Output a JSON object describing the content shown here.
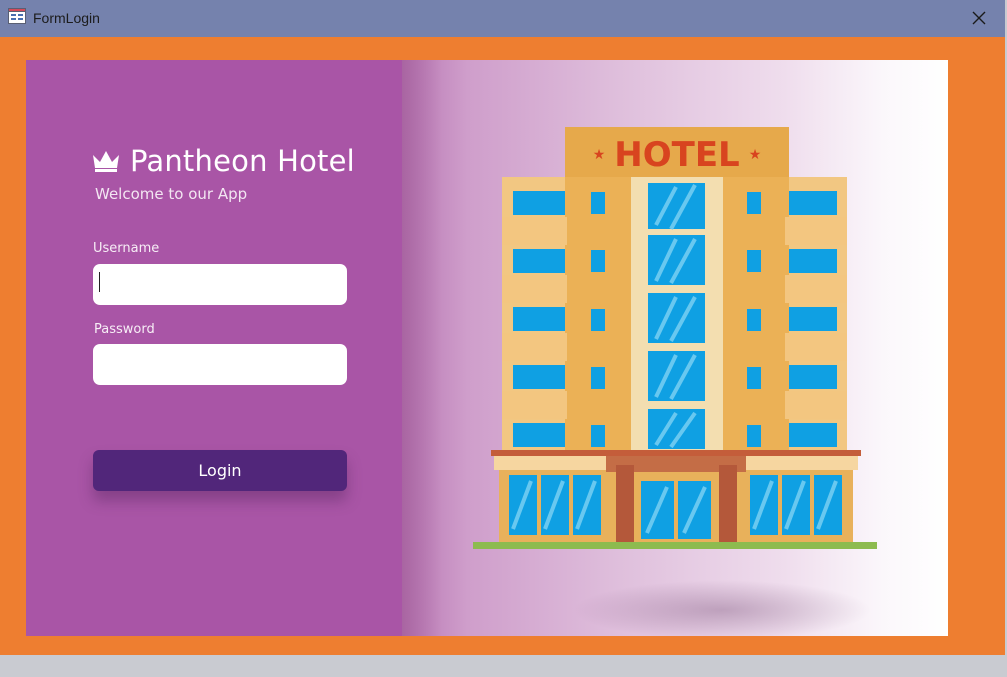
{
  "window": {
    "title": "FormLogin",
    "icon": "form-app-icon",
    "close_icon": "close-icon"
  },
  "colors": {
    "background_orange": "#ee7e30",
    "titlebar": "#7582ad",
    "left_panel": "#a955a6",
    "login_button": "#51267a"
  },
  "brand": {
    "icon": "crown-icon",
    "name": "Pantheon Hotel",
    "welcome": "Welcome to our App"
  },
  "form": {
    "username_label": "Username",
    "username_value": "",
    "password_label": "Password",
    "password_value": "",
    "login_label": "Login"
  },
  "illustration": {
    "sign_text": "HOTEL"
  }
}
